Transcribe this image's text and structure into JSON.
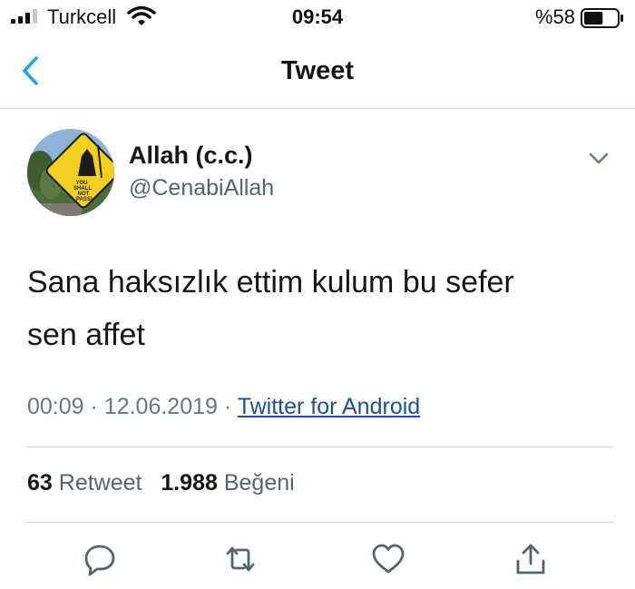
{
  "status_bar": {
    "carrier": "Turkcell",
    "time": "09:54",
    "battery_percent": "%58",
    "battery_level": 0.58
  },
  "nav": {
    "title": "Tweet"
  },
  "tweet": {
    "author_name": "Allah (c.c.)",
    "author_handle": "@CenabiAllah",
    "avatar_sign_text": [
      "YOU",
      "SHALL",
      "NOT",
      "PASS!"
    ],
    "text_line_1": "Sana haksızlık ettim kulum bu sefer",
    "text_line_2": "sen affet",
    "time": "00:09",
    "date": "12.06.2019",
    "separator": "·",
    "source": "Twitter for Android",
    "retweet_count": "63",
    "retweet_label": "Retweet",
    "like_count": "1.988",
    "like_label": "Beğeni"
  },
  "colors": {
    "text_primary": "#14171a",
    "text_secondary": "#657786",
    "link": "#1b4fa0",
    "accent": "#1da1f2",
    "icon": "#536471",
    "divider": "#cfd3d6"
  },
  "icons": {
    "back": "chevron-left-icon",
    "more": "chevron-down-icon",
    "reply": "reply-icon",
    "retweet": "retweet-icon",
    "like": "heart-icon",
    "share": "share-icon"
  }
}
